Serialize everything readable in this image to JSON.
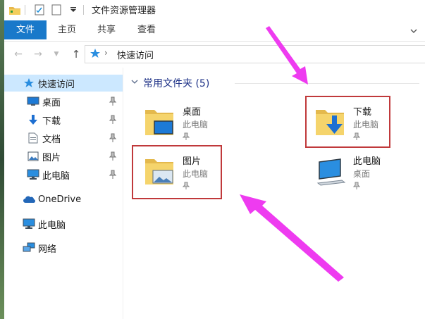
{
  "window": {
    "title": "文件资源管理器"
  },
  "ribbon": {
    "tabs": [
      "文件",
      "主页",
      "共享",
      "查看"
    ]
  },
  "address": {
    "path": "快速访问"
  },
  "navpane": {
    "quick_access": "快速访问",
    "items": [
      {
        "label": "桌面",
        "icon": "desktop-icon",
        "pinned": true
      },
      {
        "label": "下载",
        "icon": "download-icon",
        "pinned": true
      },
      {
        "label": "文档",
        "icon": "document-icon",
        "pinned": true
      },
      {
        "label": "图片",
        "icon": "pictures-icon",
        "pinned": true
      },
      {
        "label": "此电脑",
        "icon": "computer-icon",
        "pinned": true
      }
    ],
    "onedrive": "OneDrive",
    "this_pc": "此电脑",
    "network": "网络"
  },
  "content": {
    "group_title": "常用文件夹 (5)",
    "tiles": [
      {
        "name": "桌面",
        "location": "此电脑"
      },
      {
        "name": "下载",
        "location": "此电脑"
      },
      {
        "name": "图片",
        "location": "此电脑"
      },
      {
        "name": "此电脑",
        "location": "桌面"
      }
    ]
  },
  "colors": {
    "accent": "#1979ca",
    "selection": "#cce8ff",
    "highlight_box": "#c0393b",
    "arrow": "#ee3bf0"
  }
}
